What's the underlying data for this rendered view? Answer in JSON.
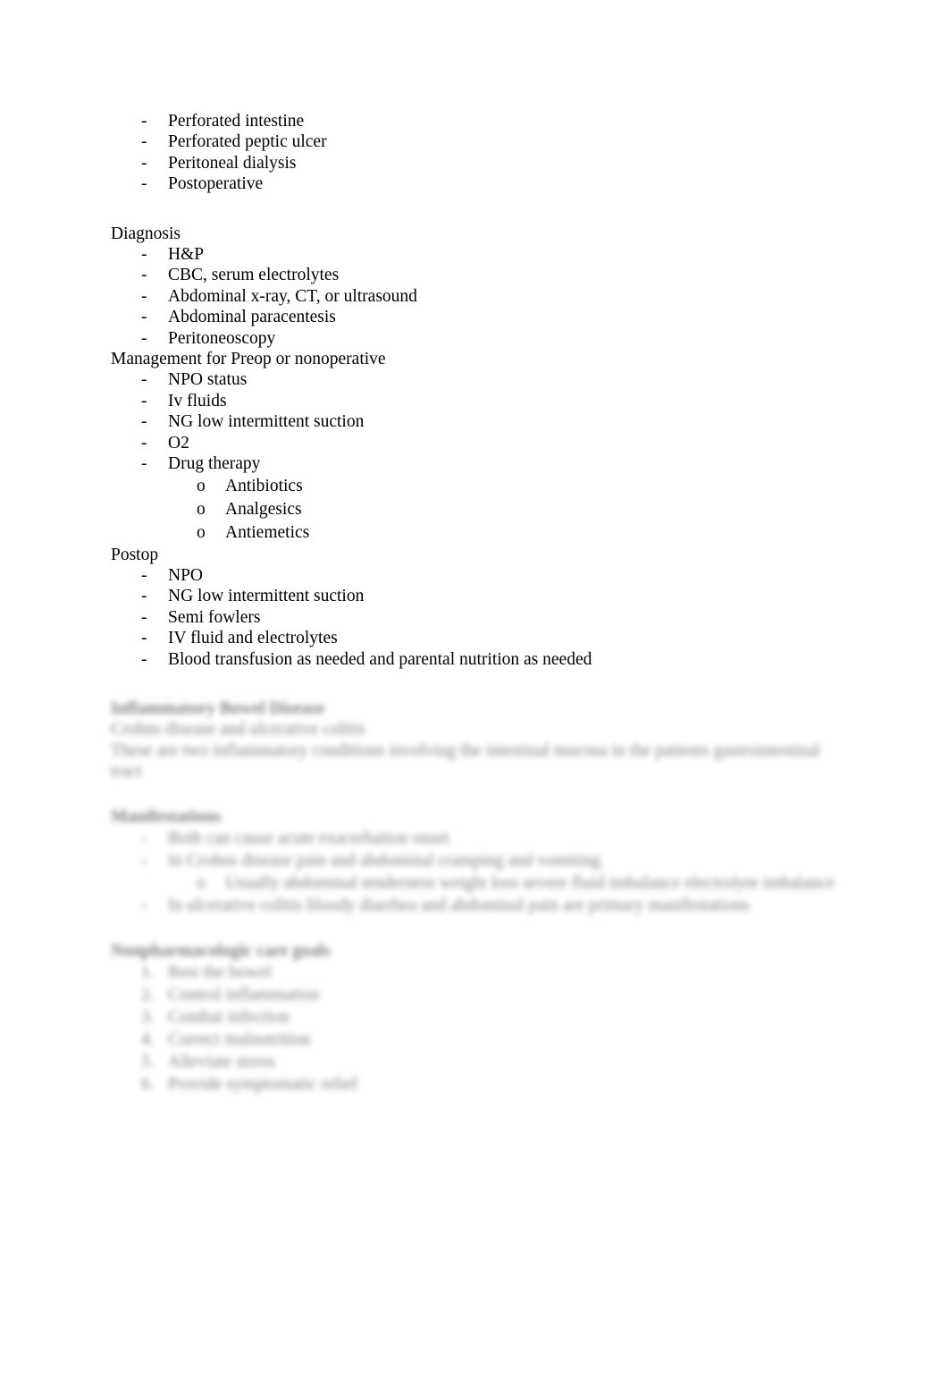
{
  "document": {
    "background_color": "#ffffff",
    "text_color": "#000000"
  },
  "sections": {
    "causes_tail": {
      "items": [
        {
          "marker": "-",
          "text": "Perforated intestine"
        },
        {
          "marker": "-",
          "text": "Perforated peptic ulcer"
        },
        {
          "marker": "-",
          "text": "Peritoneal dialysis"
        },
        {
          "marker": "-",
          "text": "Postoperative"
        }
      ]
    },
    "diagnosis": {
      "heading": "Diagnosis",
      "items": [
        {
          "marker": "-",
          "text": "H&P"
        },
        {
          "marker": "-",
          "text": "CBC, serum electrolytes"
        },
        {
          "marker": "-",
          "text": "Abdominal x-ray, CT, or ultrasound"
        },
        {
          "marker": "-",
          "text": "Abdominal paracentesis"
        },
        {
          "marker": "-",
          "text": "Peritoneoscopy"
        }
      ]
    },
    "management": {
      "heading": "Management for Preop or nonoperative",
      "items": [
        {
          "marker": "-",
          "text": "NPO status"
        },
        {
          "marker": "-",
          "text": "Iv fluids"
        },
        {
          "marker": "-",
          "text": "NG low intermittent suction"
        },
        {
          "marker": "-",
          "text": "O2"
        },
        {
          "marker": "-",
          "text": "Drug therapy"
        }
      ],
      "subitems": [
        {
          "marker": "o",
          "text": "Antibiotics"
        },
        {
          "marker": "o",
          "text": "Analgesics"
        },
        {
          "marker": "o",
          "text": "Antiemetics"
        }
      ]
    },
    "postop": {
      "heading": "Postop",
      "items": [
        {
          "marker": "-",
          "text": "NPO"
        },
        {
          "marker": "-",
          "text": "NG low intermittent suction"
        },
        {
          "marker": "-",
          "text": "Semi fowlers"
        },
        {
          "marker": "-",
          "text": "IV fluid and electrolytes"
        },
        {
          "marker": "-",
          "text": "Blood transfusion as needed and parental nutrition as needed"
        }
      ]
    },
    "blurred_block_one": {
      "heading": "Inflammatory Bowel Disease",
      "lines": [
        "Crohns disease and ulcerative colitis",
        "These are two inflammatory conditions involving the intestinal mucosa in the patients gastrointestinal tract"
      ]
    },
    "blurred_block_two": {
      "heading": "Manifestations",
      "items": [
        {
          "marker": "-",
          "text": "Both can cause acute exacerbation onset"
        },
        {
          "marker": "-",
          "text": "In Crohns disease pain and abdominal cramping and vomiting"
        }
      ],
      "subitems": [
        {
          "marker": "o",
          "text": "Usually abdominal tenderness weight loss severe fluid imbalance electrolyte imbalance"
        }
      ],
      "items_tail": [
        {
          "marker": "-",
          "text": "In ulcerative colitis bloody diarrhea and abdominal pain are primary manifestations"
        }
      ]
    },
    "blurred_block_three": {
      "heading": "Nonpharmacologic care goals",
      "items": [
        {
          "marker": "1.",
          "text": "Rest the bowel"
        },
        {
          "marker": "2.",
          "text": "Control inflammation"
        },
        {
          "marker": "3.",
          "text": "Combat infection"
        },
        {
          "marker": "4.",
          "text": "Correct malnutrition"
        },
        {
          "marker": "5.",
          "text": "Alleviate stress"
        },
        {
          "marker": "6.",
          "text": "Provide symptomatic relief"
        }
      ]
    }
  }
}
